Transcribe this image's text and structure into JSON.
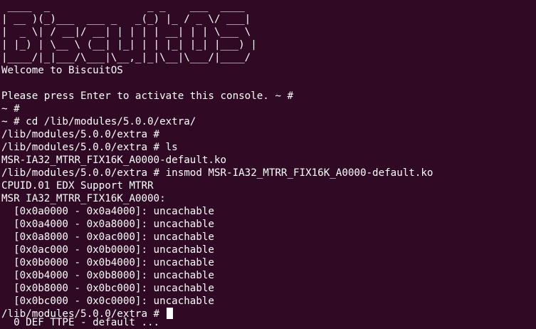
{
  "terminal": {
    "colors": {
      "background": "#300a24",
      "foreground": "#ffffff"
    },
    "lines": [
      " ____  _                _ _    ___  ____",
      "| __ )(_)___  ___ _   _(_) |_ / _ \\/ ___|",
      "|  _ \\| / __|/ __| | | | | __| | | \\___ \\",
      "| |_) | \\__ \\ (__| |_| | | |_| |_| |___) |",
      "|____/|_|___/\\___|\\__,_|_|\\__|\\___/|____/",
      "Welcome to BiscuitOS",
      "",
      "Please press Enter to activate this console. ~ #",
      "~ #",
      "~ # cd /lib/modules/5.0.0/extra/",
      "/lib/modules/5.0.0/extra #",
      "/lib/modules/5.0.0/extra # ls",
      "MSR-IA32_MTRR_FIX16K_A0000-default.ko",
      "/lib/modules/5.0.0/extra # insmod MSR-IA32_MTRR_FIX16K_A0000-default.ko",
      "CPUID.01 EDX Support MTRR",
      "MSR IA32_MTRR_FIX16K_A0000:",
      "  [0x0a0000 - 0x0a4000]: uncachable",
      "  [0x0a4000 - 0x0a8000]: uncachable",
      "  [0x0a8000 - 0x0ac000]: uncachable",
      "  [0x0ac000 - 0x0b0000]: uncachable",
      "  [0x0b0000 - 0x0b4000]: uncachable",
      "  [0x0b4000 - 0x0b8000]: uncachable",
      "  [0x0b8000 - 0x0bc000]: uncachable",
      "  [0x0bc000 - 0x0c0000]: uncachable"
    ],
    "prompt": "/lib/modules/5.0.0/extra # ",
    "cut_line": "  0 DEF TTPE - default ..."
  }
}
